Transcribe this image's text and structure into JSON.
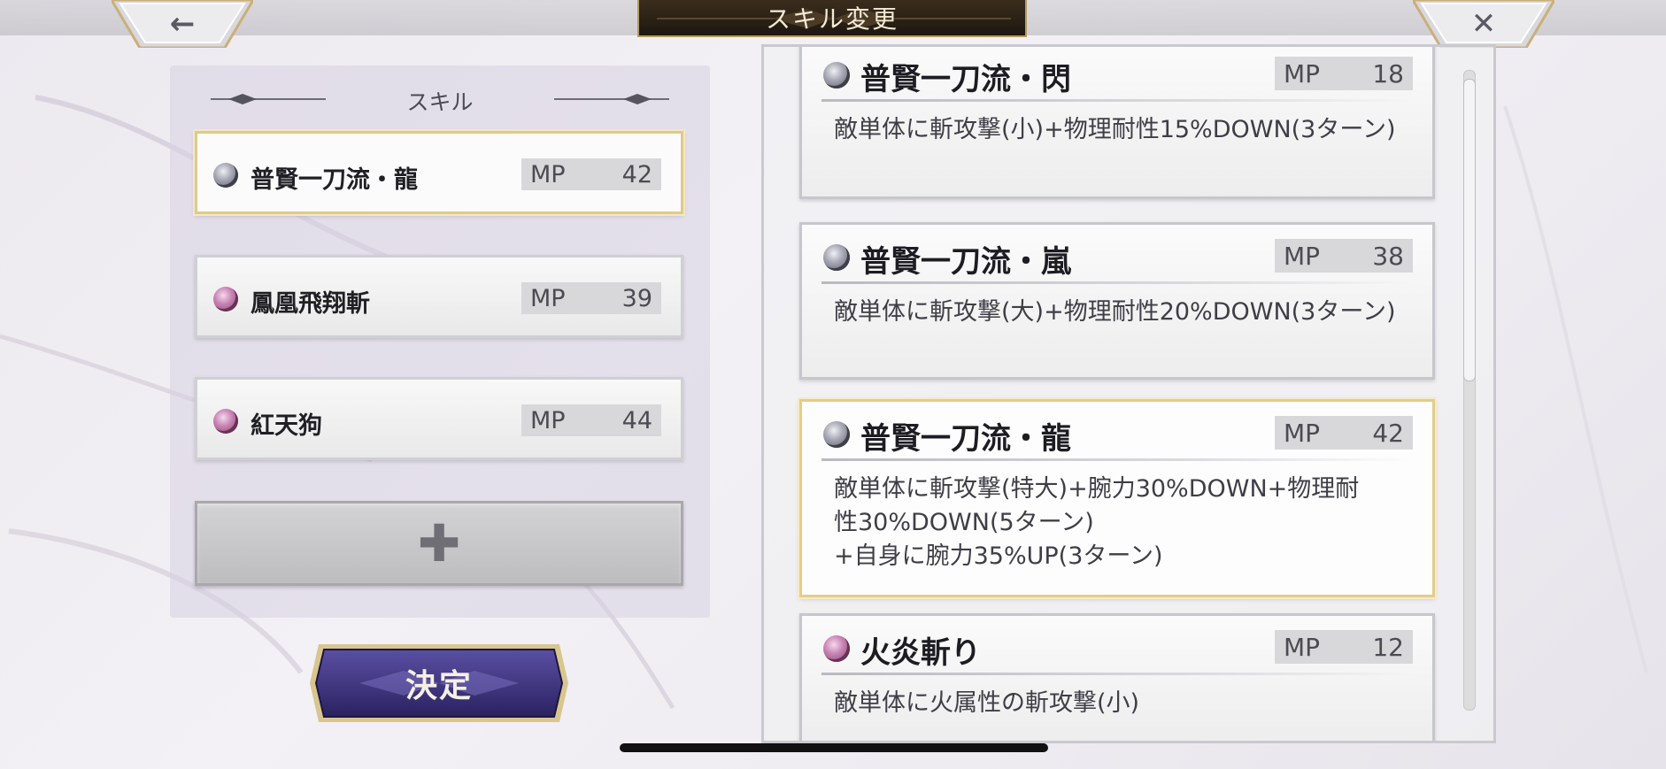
{
  "header": {
    "title": "スキル変更",
    "back_icon": "←",
    "close_icon": "✕"
  },
  "left_panel": {
    "header_label": "スキル",
    "slots": [
      {
        "name": "普賢一刀流・龍",
        "mp_label": "MP",
        "mp": "42",
        "orb": "grey",
        "selected": true
      },
      {
        "name": "鳳凰飛翔斬",
        "mp_label": "MP",
        "mp": "39",
        "orb": "pink",
        "selected": false
      },
      {
        "name": "紅天狗",
        "mp_label": "MP",
        "mp": "44",
        "orb": "pink",
        "selected": false
      }
    ],
    "add_label": "✚"
  },
  "confirm_button": {
    "label": "決定"
  },
  "skill_list": [
    {
      "name": "普賢一刀流・閃",
      "mp_label": "MP",
      "mp": "18",
      "orb": "grey",
      "description": "敵単体に斬攻撃(小)+物理耐性15%DOWN(3ターン)",
      "selected": false
    },
    {
      "name": "普賢一刀流・嵐",
      "mp_label": "MP",
      "mp": "38",
      "orb": "grey",
      "description": "敵単体に斬攻撃(大)+物理耐性20%DOWN(3ターン)",
      "selected": false
    },
    {
      "name": "普賢一刀流・龍",
      "mp_label": "MP",
      "mp": "42",
      "orb": "grey",
      "description_lines": [
        "敵単体に斬攻撃(特大)+腕力30%DOWN+物理耐",
        "性30%DOWN(5ターン)",
        "+自身に腕力35%UP(3ターン)"
      ],
      "selected": true
    },
    {
      "name": "火炎斬り",
      "mp_label": "MP",
      "mp": "12",
      "orb": "pink",
      "description": "敵単体に火属性の斬攻撃(小)",
      "selected": false
    }
  ],
  "colors": {
    "accent_gold": "#e0c98a",
    "title_plate": "#2a2016",
    "confirm_purple": "#3a2f7a"
  }
}
